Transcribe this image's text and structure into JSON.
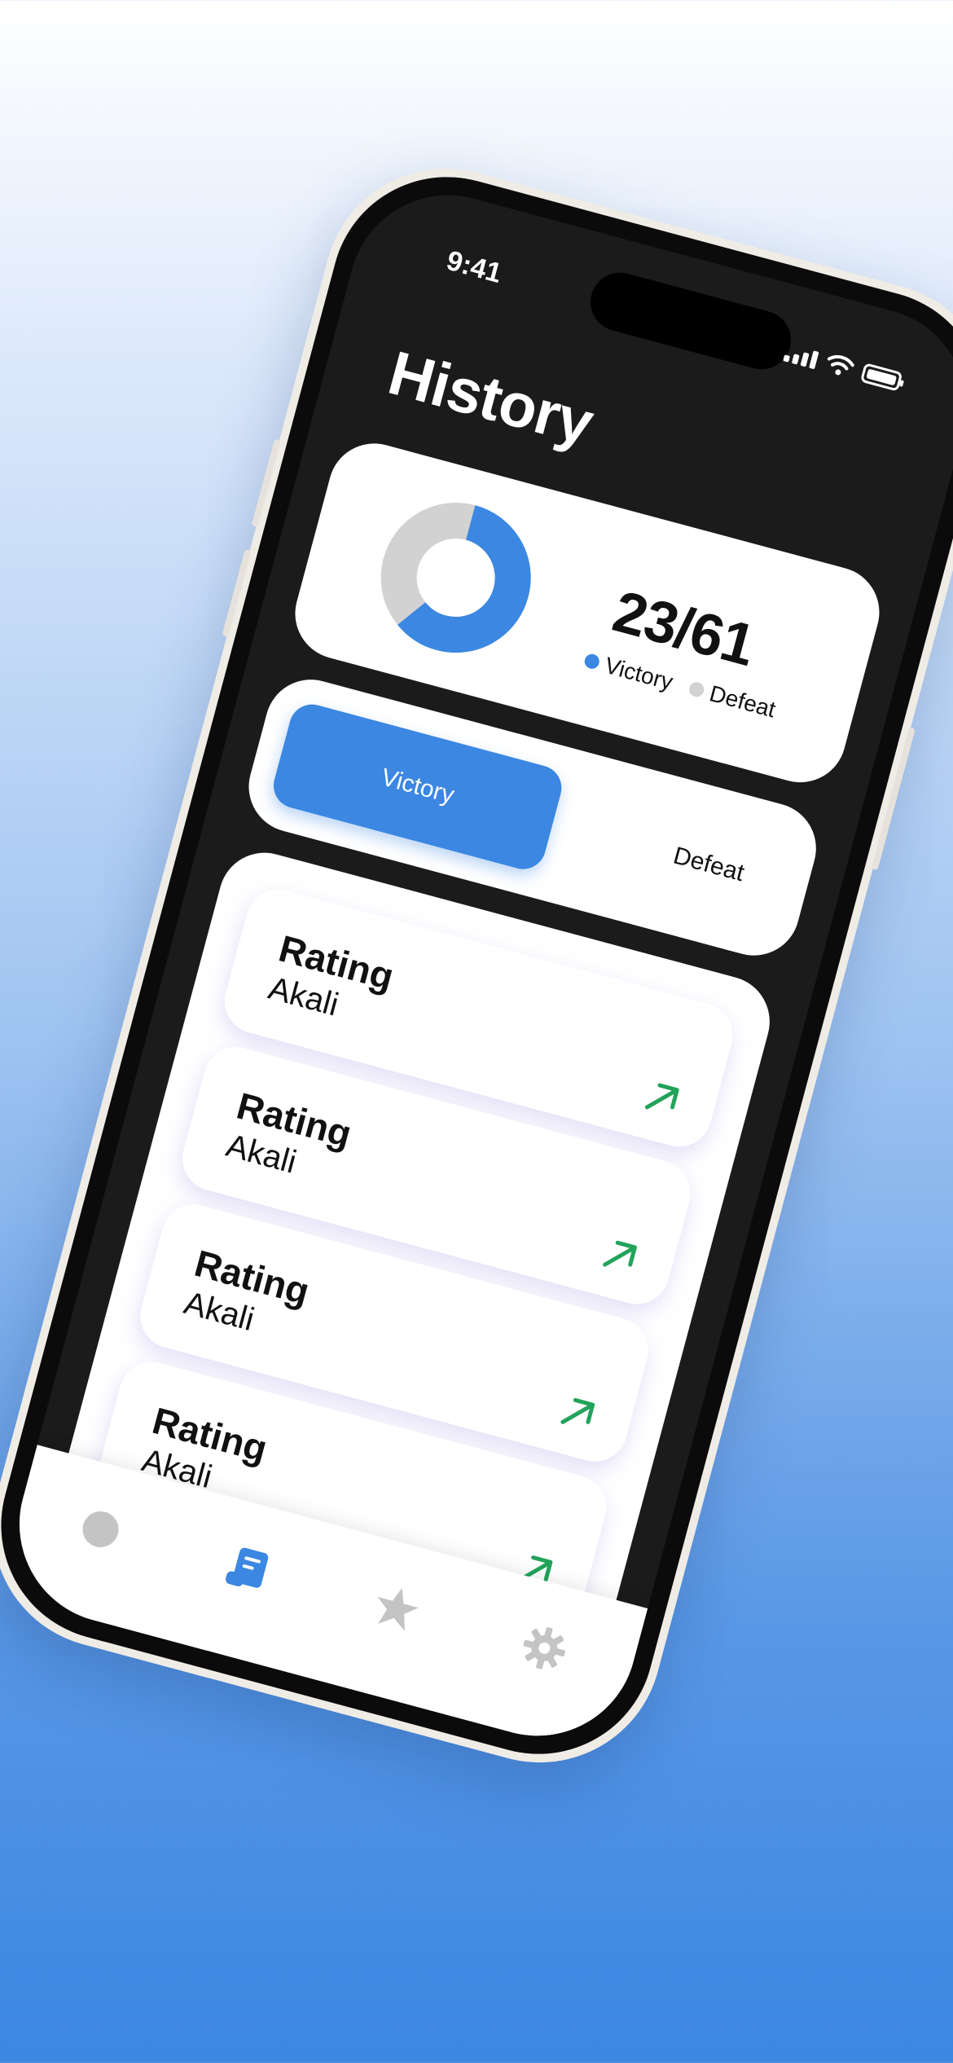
{
  "status_bar": {
    "time": "9:41"
  },
  "page": {
    "title": "History"
  },
  "stats": {
    "score": "23/61",
    "victories": 23,
    "total": 61,
    "legend": [
      {
        "label": "Victory",
        "color": "#3b87e2"
      },
      {
        "label": "Defeat",
        "color": "#d2d2d2"
      }
    ]
  },
  "filter": {
    "options": [
      "Victory",
      "Defeat"
    ],
    "selected": "Victory"
  },
  "history_items": [
    {
      "title": "Rating",
      "champion": "Akali",
      "trend_icon": "arrow-up-right-icon"
    },
    {
      "title": "Rating",
      "champion": "Akali",
      "trend_icon": "arrow-up-right-icon"
    },
    {
      "title": "Rating",
      "champion": "Akali",
      "trend_icon": "arrow-up-right-icon"
    },
    {
      "title": "Rating",
      "champion": "Akali",
      "trend_icon": "arrow-up-right-icon"
    }
  ],
  "tab_bar": {
    "tabs": [
      {
        "icon": "circle-icon",
        "active": false
      },
      {
        "icon": "scroll-icon",
        "active": true
      },
      {
        "icon": "star-icon",
        "active": false
      },
      {
        "icon": "gear-icon",
        "active": false
      }
    ]
  },
  "colors": {
    "accent": "#3b87e2",
    "trend_up": "#22a35a",
    "inactive": "#c4c4c4"
  }
}
